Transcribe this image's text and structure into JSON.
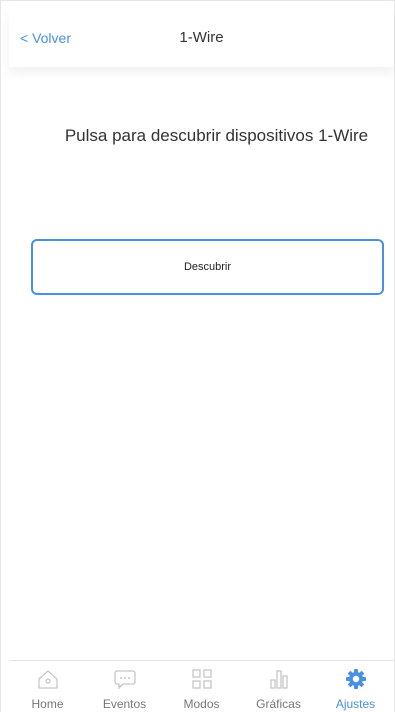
{
  "header": {
    "back_label": "< Volver",
    "title": "1-Wire"
  },
  "main": {
    "prompt": "Pulsa para descubrir dispositivos 1-Wire",
    "discover_button": "Descubrir"
  },
  "tabbar": {
    "active_color": "#4a90e2",
    "items": [
      {
        "label": "Home",
        "icon": "home-icon"
      },
      {
        "label": "Eventos",
        "icon": "chat-icon"
      },
      {
        "label": "Modos",
        "icon": "grid-icon"
      },
      {
        "label": "Gráficas",
        "icon": "bar-chart-icon"
      },
      {
        "label": "Ajustes",
        "icon": "gear-icon",
        "active": true
      }
    ]
  }
}
